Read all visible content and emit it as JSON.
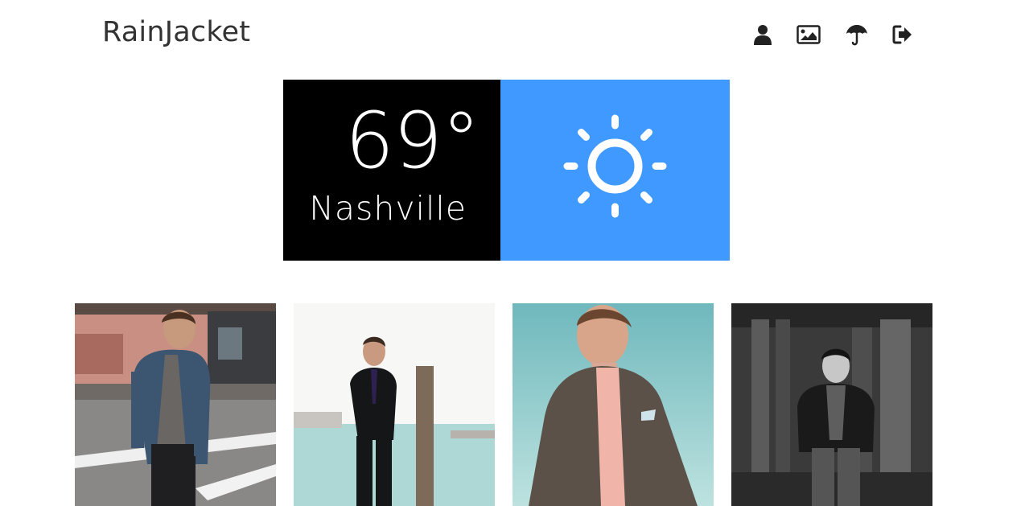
{
  "header": {
    "brand": "RainJacket",
    "nav": [
      {
        "icon": "user-icon"
      },
      {
        "icon": "gallery-icon"
      },
      {
        "icon": "umbrella-icon"
      },
      {
        "icon": "logout-icon"
      }
    ]
  },
  "weather": {
    "temperature": "69°",
    "city": "Nashville",
    "condition_icon": "sun-icon",
    "panel_color": "#3f99ff"
  },
  "photos": [
    {
      "name": "outfit-photo-street-blazer"
    },
    {
      "name": "outfit-photo-black-suit"
    },
    {
      "name": "outfit-photo-grey-blazer"
    },
    {
      "name": "outfit-photo-leather-jacket"
    }
  ]
}
